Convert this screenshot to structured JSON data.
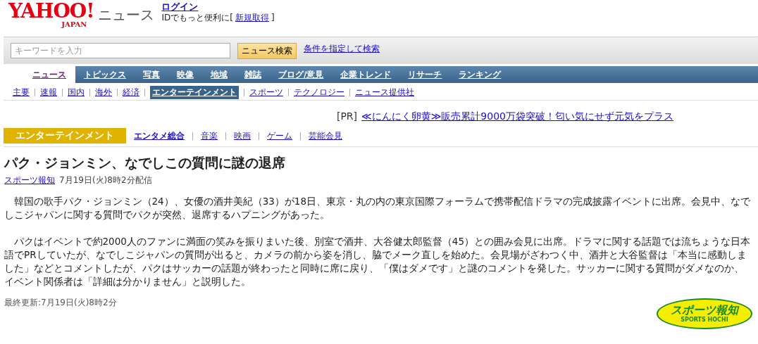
{
  "header": {
    "logo": {
      "main": "YAHOO!",
      "sub": "JAPAN"
    },
    "service": "ニュース",
    "login": "ログイン",
    "id_text": "IDでもっと便利に[",
    "signup": "新規取得",
    "id_close": "]"
  },
  "search": {
    "placeholder": "キーワードを入力",
    "button": "ニュース検索",
    "advanced": "条件を指定して検索"
  },
  "tabs": [
    {
      "label": "ニュース",
      "selected": true
    },
    {
      "label": "トピックス",
      "selected": false
    },
    {
      "label": "写真",
      "selected": false
    },
    {
      "label": "映像",
      "selected": false
    },
    {
      "label": "地域",
      "selected": false
    },
    {
      "label": "雑誌",
      "selected": false
    },
    {
      "label": "ブログ/意見",
      "selected": false
    },
    {
      "label": "企業トレンド",
      "selected": false
    },
    {
      "label": "リサーチ",
      "selected": false
    },
    {
      "label": "ランキング",
      "selected": false
    }
  ],
  "subnav": [
    {
      "label": "主要",
      "selected": false
    },
    {
      "label": "速報",
      "selected": false
    },
    {
      "label": "国内",
      "selected": false
    },
    {
      "label": "海外",
      "selected": false
    },
    {
      "label": "経済",
      "selected": false
    },
    {
      "label": "エンターテインメント",
      "selected": true
    },
    {
      "label": "スポーツ",
      "selected": false
    },
    {
      "label": "テクノロジー",
      "selected": false
    },
    {
      "label": "ニュース提供社",
      "selected": false
    }
  ],
  "pr": {
    "tag": "[PR]",
    "link": "≪にんにく卵黄≫販売累計9000万袋突破！匂い気にせず元気をプラス"
  },
  "section": {
    "title": "エンターテインメント",
    "items": [
      {
        "label": "エンタメ総合",
        "selected": true
      },
      {
        "label": "音楽",
        "selected": false
      },
      {
        "label": "映画",
        "selected": false
      },
      {
        "label": "ゲーム",
        "selected": false
      },
      {
        "label": "芸能会見",
        "selected": false
      }
    ]
  },
  "article": {
    "title": "パク・ジョンミン、なでしこの質問に謎の退席",
    "source": "スポーツ報知",
    "date": "7月19日(火)8時2分配信",
    "paragraphs": [
      "韓国の歌手パク・ジョンミン（24）、女優の酒井美紀（33）が18日、東京・丸の内の東京国際フォーラムで携帯配信ドラマの完成披露イベントに出席。会見中、なでしこジャパンに関する質問でパクが突然、退席するハプニングがあった。",
      "パクはイベントで約2000人のファンに満面の笑みを振りまいた後、別室で酒井、大谷健太郎監督（45）との囲み会見に出席。ドラマに関する話題では流ちょうな日本語でPRしていたが、なでしこジャパンの質問が出ると、カメラの前から姿を消し、脇でメーク直しを始めた。会見場がざわつく中、酒井と大谷監督は「本当に感動しました」などとコメントしたが、パクはサッカーの話題が終わったと同時に席に戻り、「僕はダメです」と謎のコメントを発した。サッカーに関する質問がダメなのか、イベント関係者は「詳細は分かりません」と説明した。"
    ],
    "updated": "最終更新:7月19日(火)8時2分"
  },
  "provider_logo": {
    "main": "スポーツ報知",
    "sub": "SPORTS HOCHI"
  }
}
